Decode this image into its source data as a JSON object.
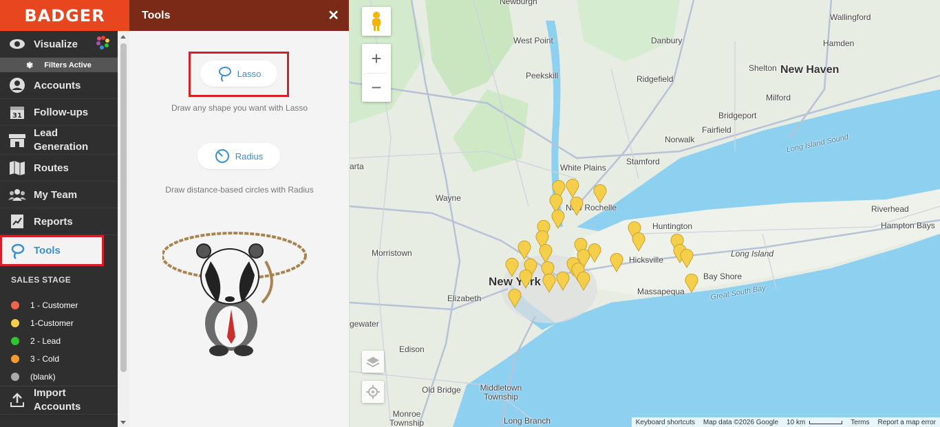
{
  "brand": {
    "logo_text": "BADGER"
  },
  "sidebar": {
    "items": [
      {
        "label": "Visualize",
        "icon": "eye-icon"
      },
      {
        "label": "Accounts",
        "icon": "user-circle-icon"
      },
      {
        "label": "Follow-ups",
        "icon": "calendar-icon"
      },
      {
        "label": "Lead Generation",
        "icon": "storefront-icon"
      },
      {
        "label": "Routes",
        "icon": "map-icon"
      },
      {
        "label": "My Team",
        "icon": "team-icon"
      },
      {
        "label": "Reports",
        "icon": "report-icon"
      },
      {
        "label": "Tools",
        "icon": "lasso-icon"
      },
      {
        "label": "Import Accounts",
        "icon": "upload-icon"
      }
    ],
    "filters_label": "Filters Active",
    "sales_stage_title": "SALES STAGE",
    "stages": [
      {
        "label": "1 - Customer",
        "color": "#f0654a"
      },
      {
        "label": "1-Customer",
        "color": "#f5cf4a"
      },
      {
        "label": "2 - Lead",
        "color": "#2ec52e"
      },
      {
        "label": "3 - Cold",
        "color": "#f59a2e"
      },
      {
        "label": "(blank)",
        "color": "#aaaaaa"
      }
    ]
  },
  "panel": {
    "title": "Tools",
    "lasso_label": "Lasso",
    "lasso_desc": "Draw any shape you want with Lasso",
    "radius_label": "Radius",
    "radius_desc": "Draw distance-based circles with Radius"
  },
  "map": {
    "labels": {
      "new_haven": "New Haven",
      "new_york": "New York",
      "bridgeport": "Bridgeport",
      "stamford": "Stamford",
      "white_plains": "White Plains",
      "new_rochelle": "New Rochelle",
      "huntington": "Huntington",
      "hicksville": "Hicksville",
      "massapequa": "Massapequa",
      "bay_shore": "Bay Shore",
      "long_island": "Long Island",
      "riverhead": "Riverhead",
      "hampton_bays": "Hampton Bays",
      "long_island_sound": "Long Island Sound",
      "great_south_bay": "Great South Bay",
      "newburgh": "Newburgh",
      "danbury": "Danbury",
      "wallingford": "Wallingford",
      "hamden": "Hamden",
      "shelton": "Shelton",
      "milford": "Milford",
      "fairfield": "Fairfield",
      "norwalk": "Norwalk",
      "ridgefield": "Ridgefield",
      "peekskill": "Peekskill",
      "west_point": "West Point",
      "wayne": "Wayne",
      "morristown": "Morristown",
      "elizabeth": "Elizabeth",
      "edison": "Edison",
      "old_bridge": "Old Bridge",
      "middletown_township": "Middletown Township",
      "long_branch": "Long Branch",
      "monroe_township": "Monroe Township",
      "gewater": "gewater",
      "arta": "arta"
    },
    "attribution": {
      "shortcuts": "Keyboard shortcuts",
      "data": "Map data ©2026 Google",
      "scale": "10 km",
      "terms": "Terms",
      "report": "Report a map error"
    }
  }
}
